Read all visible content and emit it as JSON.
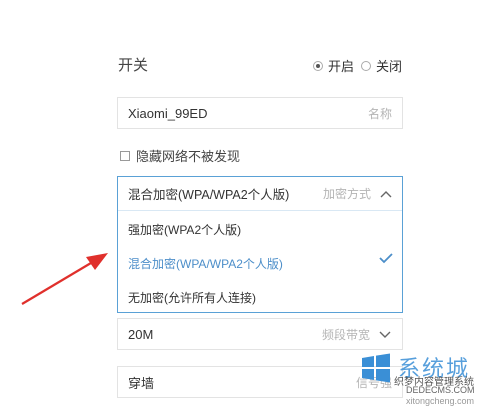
{
  "switch": {
    "label": "开关",
    "options": [
      {
        "label": "开启",
        "selected": true
      },
      {
        "label": "关闭",
        "selected": false
      }
    ]
  },
  "ssid": {
    "value": "Xiaomi_99ED",
    "placeholder": "名称"
  },
  "hide_network": {
    "label": "隐藏网络不被发现",
    "checked": false
  },
  "encryption": {
    "value": "混合加密(WPA/WPA2个人版)",
    "hint": "加密方式",
    "options": [
      {
        "label": "强加密(WPA2个人版)",
        "selected": false
      },
      {
        "label": "混合加密(WPA/WPA2个人版)",
        "selected": true
      },
      {
        "label": "无加密(允许所有人连接)",
        "selected": false
      }
    ]
  },
  "bandwidth": {
    "value": "20M",
    "hint": "频段带宽"
  },
  "signal": {
    "value": "穿墙",
    "hint": "信号强"
  },
  "watermark": {
    "title": "系统城",
    "line1": "织梦内容管理系统",
    "line2": "DEDECMS.COM",
    "line3": "xitongcheng.com"
  },
  "colors": {
    "accent": "#4c8ec9",
    "arrow": "#e0302c"
  }
}
